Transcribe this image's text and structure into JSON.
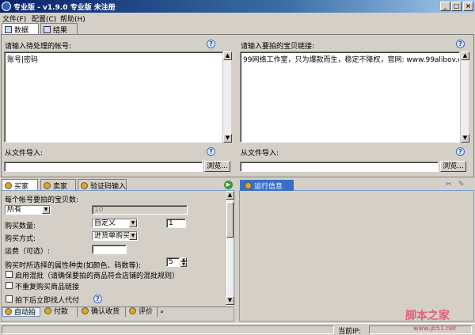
{
  "window": {
    "title": "专业版 - v1.9.0 专业版 未注册"
  },
  "menu": [
    "文件(F)",
    "配置(C)",
    "帮助(H)"
  ],
  "top_tabs": [
    "数据",
    "结果"
  ],
  "left_panel": {
    "label": "请输入待处理的帐号:",
    "value": "账号|密码",
    "import_label": "从文件导入:",
    "browse": "浏览..."
  },
  "right_panel": {
    "label": "请输入要拍的宝贝链接:",
    "value": "99网络工作室，只为爆款而生，稳定不降权，官网: www.99alibov.com",
    "import_label": "从文件导入:",
    "browse": "浏览..."
  },
  "bottom_tabs": [
    "买家",
    "卖家",
    "验证码输入"
  ],
  "run_info": {
    "title": "运行信息"
  },
  "form": {
    "count_label": "每个帐号要拍的宝贝数:",
    "count_select": "所有",
    "count_value": "10",
    "qty_label": "购买数量:",
    "qty_select": "自定义",
    "qty_value": "1",
    "method_label": "购买方式:",
    "method_select": "进货单购买",
    "freight_label": "运费（可选）:",
    "freight_value": "",
    "attr_label": "购买时所选择的属性种类(如颜色、码数等):",
    "attr_value": "5",
    "checkbox1": "启用混批（请确保要拍的商品符合店铺的混批规则）",
    "checkbox2": "不重复购买商品链接",
    "checkbox3": "拍下后立即找人代付"
  },
  "bottom_subtabs": [
    "自动拍",
    "付款",
    "确认收货",
    "评价"
  ],
  "status": {
    "ip_label": "当前IP:"
  },
  "watermark": {
    "brand": "脚本之家",
    "url": "www.jb51.net"
  }
}
